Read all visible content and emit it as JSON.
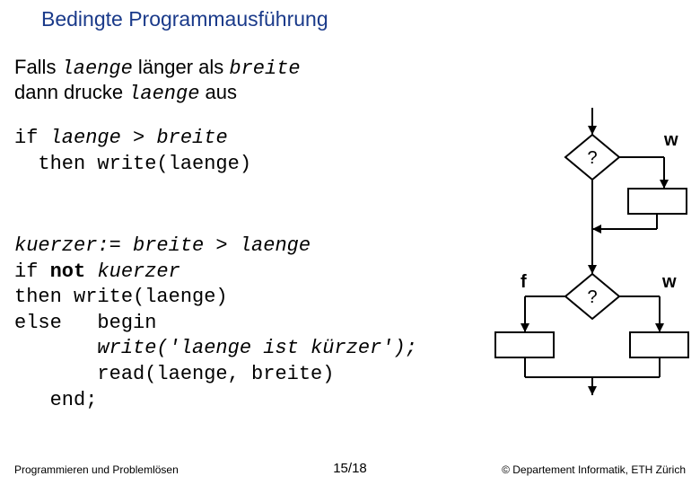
{
  "title": "Bedingte Programmausführung",
  "intro": {
    "l1a": "Falls ",
    "l1b": "laenge",
    "l1c": "  länger als ",
    "l1d": "breite",
    "l2a": "dann drucke ",
    "l2b": "laenge",
    "l2c": "  aus"
  },
  "code1": {
    "l1a": "if ",
    "l1b": "laenge > breite",
    "l2": "  then write(laenge)"
  },
  "code2": {
    "l1": "kuerzer:= breite > laenge",
    "l2a": "if ",
    "l2b": "not",
    "l2c": " kuerzer",
    "l3": "then write(laenge)",
    "l4": "else   begin",
    "l5": "       write('laenge ist kürzer');",
    "l6": "       read(laenge, breite)",
    "l7": "   end;"
  },
  "diagram": {
    "q1": "?",
    "w1": "w",
    "f": "f",
    "w2": "w",
    "q2": "?"
  },
  "footer": {
    "left": "Programmieren und Problemlösen",
    "center": "15/18",
    "right": "© Departement Informatik, ETH Zürich"
  }
}
